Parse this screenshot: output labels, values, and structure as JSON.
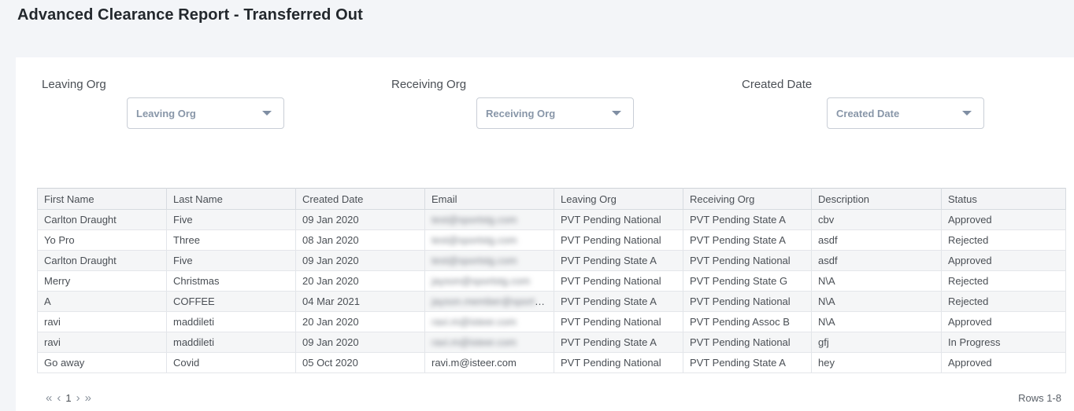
{
  "page": {
    "title": "Advanced Clearance Report - Transferred Out"
  },
  "filters": [
    {
      "label": "Leaving Org",
      "placeholder": "Leaving Org"
    },
    {
      "label": "Receiving Org",
      "placeholder": "Receiving Org"
    },
    {
      "label": "Created Date",
      "placeholder": "Created Date"
    }
  ],
  "table": {
    "columns": [
      "First Name",
      "Last Name",
      "Created Date",
      "Email",
      "Leaving Org",
      "Receiving Org",
      "Description",
      "Status"
    ],
    "rows": [
      [
        "Carlton Draught",
        "Five",
        "09 Jan 2020",
        "test@sportstg.com",
        "PVT Pending National",
        "PVT Pending State A",
        "cbv",
        "Approved"
      ],
      [
        "Yo Pro",
        "Three",
        "08 Jan 2020",
        "test@sportstg.com",
        "PVT Pending National",
        "PVT Pending State A",
        "asdf",
        "Rejected"
      ],
      [
        "Carlton Draught",
        "Five",
        "09 Jan 2020",
        "test@sportstg.com",
        "PVT Pending State A",
        "PVT Pending National",
        "asdf",
        "Approved"
      ],
      [
        "Merry",
        "Christmas",
        "20 Jan 2020",
        "jayson@sportstg.com",
        "PVT Pending National",
        "PVT Pending State G",
        "N\\A",
        "Rejected"
      ],
      [
        "A",
        "COFFEE",
        "04 Mar 2021",
        "jayson.member@sportstg...",
        "PVT Pending State A",
        "PVT Pending National",
        "N\\A",
        "Rejected"
      ],
      [
        "ravi",
        "maddileti",
        "20 Jan 2020",
        "ravi.m@isteer.com",
        "PVT Pending National",
        "PVT Pending Assoc B",
        "N\\A",
        "Approved"
      ],
      [
        "ravi",
        "maddileti",
        "09 Jan 2020",
        "ravi.m@isteer.com",
        "PVT Pending State A",
        "PVT Pending National",
        "gfj",
        "In Progress"
      ],
      [
        "Go away",
        "Covid",
        "05 Oct 2020",
        "ravi.m@isteer.com",
        "PVT Pending National",
        "PVT Pending State A",
        "hey",
        "Approved"
      ]
    ],
    "masked_email_rows": [
      0,
      1,
      2,
      3,
      4,
      5,
      6
    ]
  },
  "pagination": {
    "first_icon": "«",
    "prev_icon": "‹",
    "page": "1",
    "next_icon": "›",
    "last_icon": "»",
    "rows_info": "Rows 1-8"
  }
}
